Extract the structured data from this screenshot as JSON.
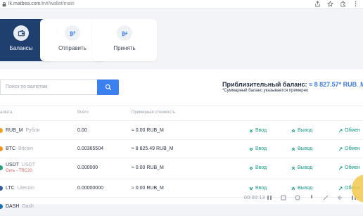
{
  "browser": {
    "url_host": "lk.matbea.com",
    "url_path": "/in#/wallet/main"
  },
  "cards": {
    "balances": "Балансы",
    "send": "Отправить",
    "receive": "Принять"
  },
  "search": {
    "placeholder": "Поиск по валютам"
  },
  "balance": {
    "title": "Приблизительный баланс:",
    "value": "≈ 8 827.57* RUB_M",
    "note": "*Суммарный баланс указывается примерно"
  },
  "table": {
    "headers": [
      "алюта",
      "Всего",
      "Примерная стоимость"
    ],
    "rows": [
      {
        "ticker": "RUB_M",
        "name": "Рубли",
        "network": "",
        "total": "0.00",
        "approx": "≈ 0.00 RUB_M",
        "color": "#f0a020"
      },
      {
        "ticker": "BTC",
        "name": "Bitcoin",
        "network": "",
        "total": "0.00365504",
        "approx": "≈ 8 825.49 RUB_M",
        "color": "#f7931a"
      },
      {
        "ticker": "USDT",
        "name": "USDT",
        "network": "Сеть - TRC20",
        "total": "0.000000",
        "approx": "≈ 0.00 RUB_M",
        "color": "#26a17b"
      },
      {
        "ticker": "LTC",
        "name": "Litecoin",
        "network": "",
        "total": "0.00000000",
        "approx": "≈ 0.00 RUB_M",
        "color": "#345d9d"
      },
      {
        "ticker": "DASH",
        "name": "Dash",
        "network": "",
        "total": "",
        "approx": "",
        "color": "#1c75bc"
      }
    ],
    "actions": {
      "deposit": "Ввод",
      "withdraw": "Вывод",
      "exchange": "Обмен"
    }
  },
  "player": {
    "timecode": "00:00:13"
  }
}
